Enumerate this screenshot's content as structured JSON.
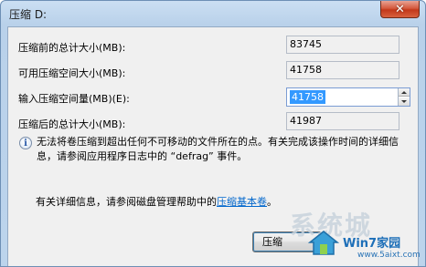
{
  "window": {
    "title": "压缩 D:",
    "close_glyph": "✕"
  },
  "fields": {
    "total_before_label": "压缩前的总计大小(MB):",
    "total_before_value": "83745",
    "available_label": "可用压缩空间大小(MB):",
    "available_value": "41758",
    "input_label": "输入压缩空间量(MB)(E):",
    "input_value": "41758",
    "total_after_label": "压缩后的总计大小(MB):",
    "total_after_value": "41987"
  },
  "info": {
    "icon": "info-icon",
    "text": "无法将卷压缩到超出任何不可移动的文件所在的点。有关完成该操作时间的详细信息，请参阅应用程序日志中的 “defrag” 事件。"
  },
  "help": {
    "prefix": "有关详细信息，请参阅磁盘管理帮助中的",
    "link": "压缩基本卷",
    "suffix": "。"
  },
  "buttons": {
    "shrink_label": "压缩"
  },
  "watermark": {
    "logo_text": "系统城",
    "brand": "Win7家园",
    "url": "www.5aixt.com"
  }
}
